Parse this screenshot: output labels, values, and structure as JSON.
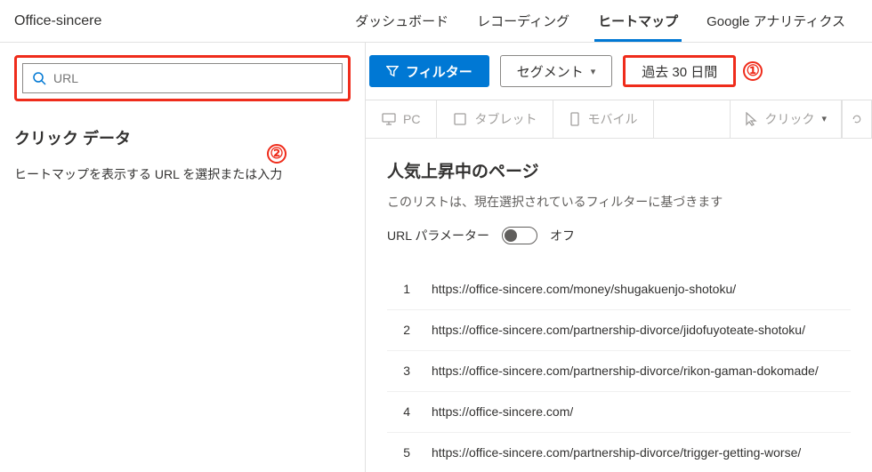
{
  "site_name": "Office-sincere",
  "nav": {
    "dashboard": "ダッシュボード",
    "recording": "レコーディング",
    "heatmap": "ヒートマップ",
    "analytics": "Google アナリティクス"
  },
  "search": {
    "placeholder": "URL"
  },
  "filterbar": {
    "filter": "フィルター",
    "segment": "セグメント",
    "daterange": "過去 30 日間"
  },
  "annotations": {
    "one": "①",
    "two": "②"
  },
  "left": {
    "title": "クリック データ",
    "subtitle": "ヒートマップを表示する URL を選択または入力"
  },
  "devices": {
    "pc": "PC",
    "tablet": "タブレット",
    "mobile": "モバイル",
    "click": "クリック"
  },
  "trending": {
    "title": "人気上昇中のページ",
    "desc": "このリストは、現在選択されているフィルターに基づきます",
    "param_label": "URL パラメーター",
    "param_state": "オフ",
    "rows": [
      {
        "idx": "1",
        "url": "https://office-sincere.com/money/shugakuenjo-shotoku/"
      },
      {
        "idx": "2",
        "url": "https://office-sincere.com/partnership-divorce/jidofuyoteate-shotoku/"
      },
      {
        "idx": "3",
        "url": "https://office-sincere.com/partnership-divorce/rikon-gaman-dokomade/"
      },
      {
        "idx": "4",
        "url": "https://office-sincere.com/"
      },
      {
        "idx": "5",
        "url": "https://office-sincere.com/partnership-divorce/trigger-getting-worse/"
      }
    ]
  }
}
